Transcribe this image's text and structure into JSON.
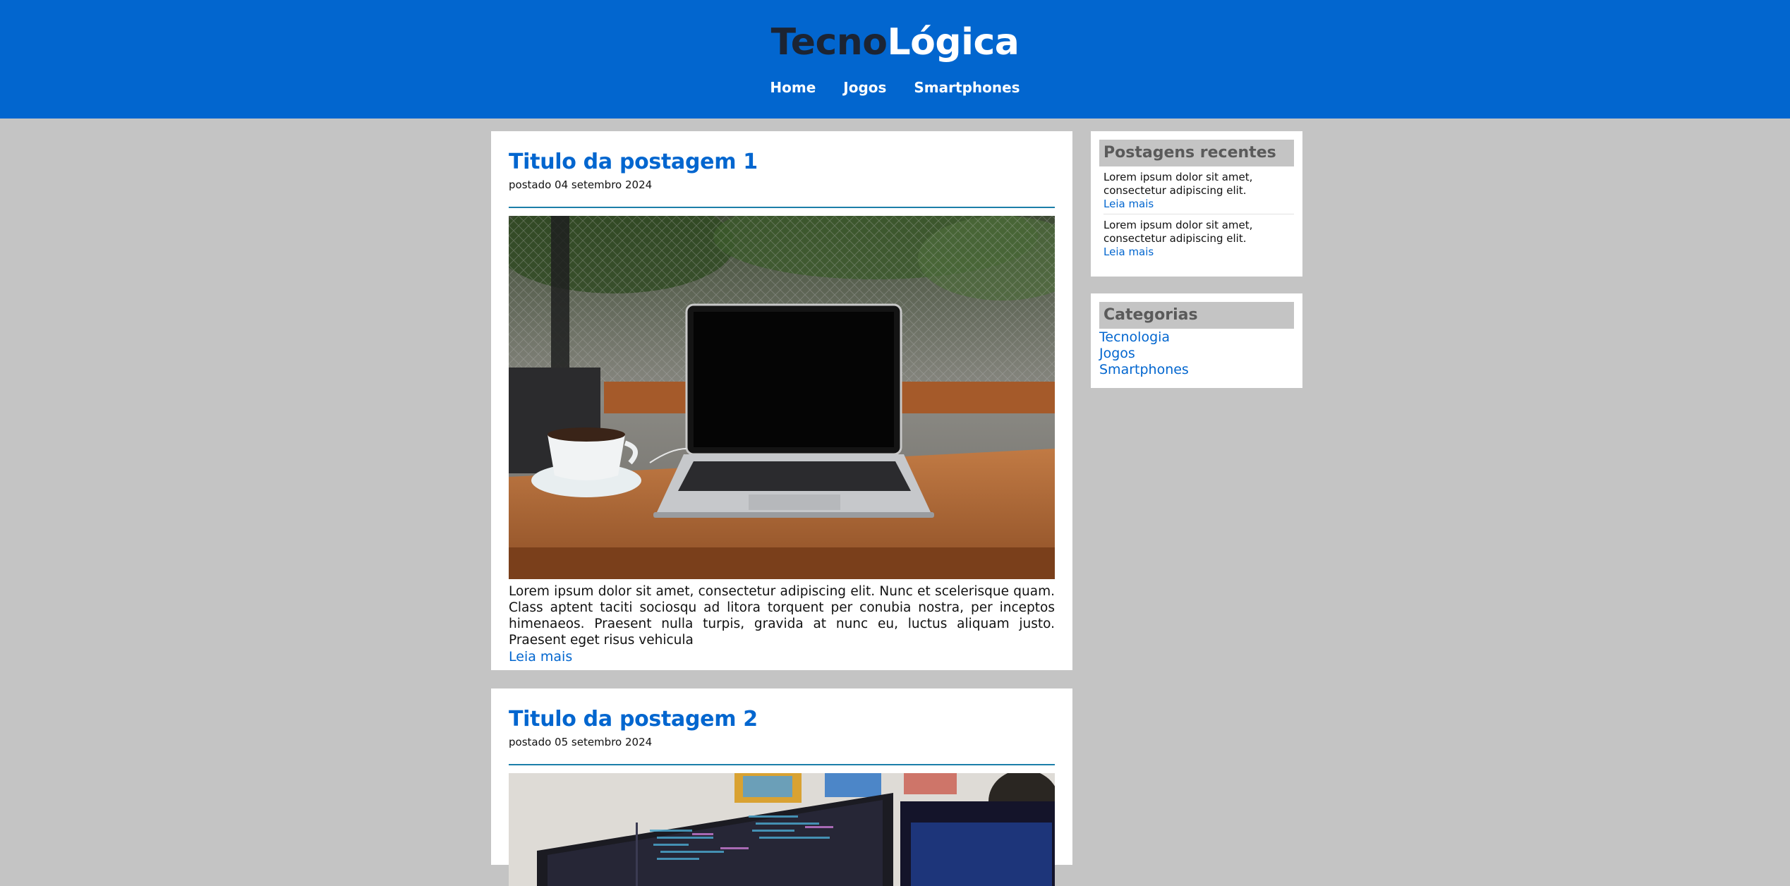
{
  "header": {
    "logo_part1": "Tecno",
    "logo_part2": "Lógica",
    "nav": [
      "Home",
      "Jogos",
      "Smartphones"
    ]
  },
  "posts": [
    {
      "title": "Titulo da postagem 1",
      "date": "postado 04 setembro 2024",
      "image": "laptop-on-desk-photo",
      "excerpt": "Lorem ipsum dolor sit amet, consectetur adipiscing elit. Nunc et scelerisque quam. Class aptent taciti sociosqu ad litora torquent per conubia nostra, per inceptos himenaeos. Praesent nulla turpis, gravida at nunc eu, luctus aliquam justo. Praesent eget risus vehicula",
      "more": "Leia mais"
    },
    {
      "title": "Titulo da postagem 2",
      "date": "postado 05 setembro 2024",
      "image": "monitors-with-code-photo"
    }
  ],
  "sidebar": {
    "recent": {
      "title": "Postagens recentes",
      "items": [
        {
          "text": "Lorem ipsum dolor sit amet, consectetur adipiscing elit.",
          "more": "Leia mais"
        },
        {
          "text": "Lorem ipsum dolor sit amet, consectetur adipiscing elit.",
          "more": "Leia mais"
        }
      ]
    },
    "categories": {
      "title": "Categorias",
      "items": [
        "Tecnologia",
        "Jogos",
        "Smartphones"
      ]
    }
  },
  "colors": {
    "brand_blue": "#0266cf",
    "page_background": "#c4c4c4"
  }
}
